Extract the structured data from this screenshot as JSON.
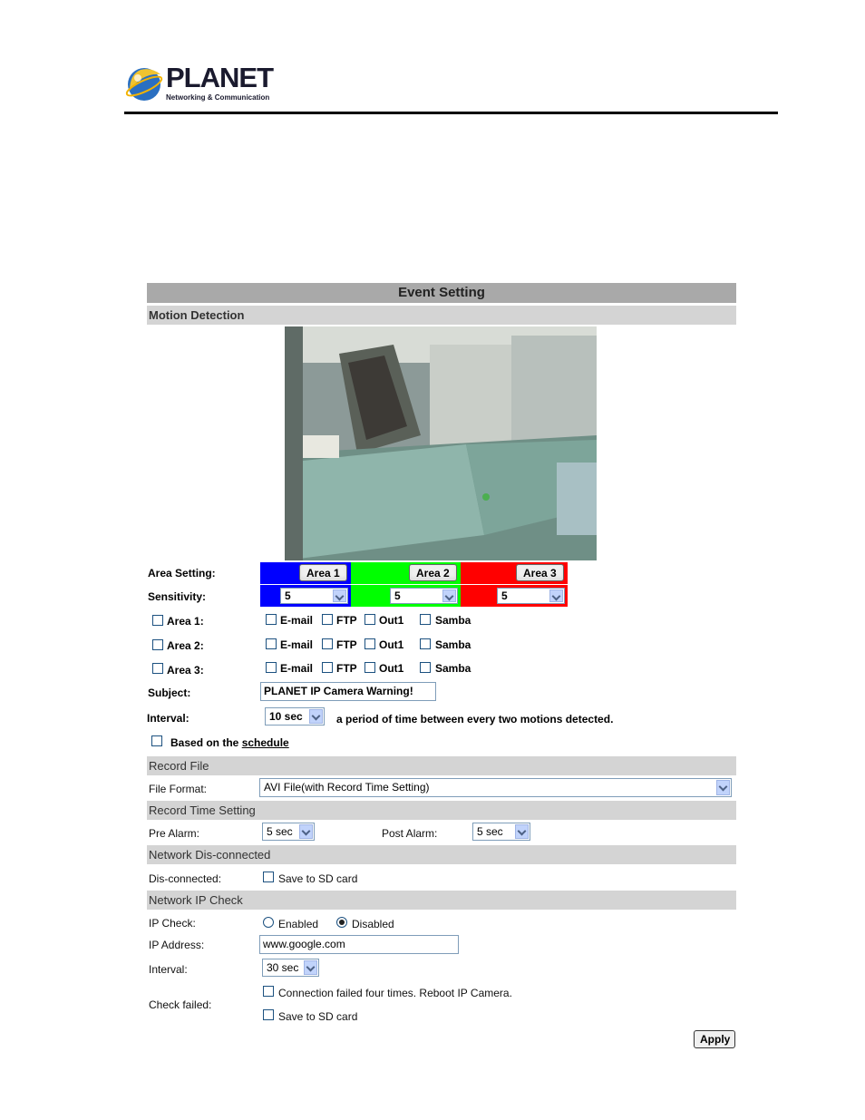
{
  "brand": {
    "name": "PLANET",
    "tagline": "Networking & Communication"
  },
  "page_title": "Event Setting",
  "motion": {
    "section": "Motion Detection",
    "area_setting_label": "Area Setting:",
    "sensitivity_label": "Sensitivity:",
    "areas": [
      {
        "button": "Area 1",
        "sensitivity": "5",
        "color": "#0000ff"
      },
      {
        "button": "Area 2",
        "sensitivity": "5",
        "color": "#00ff00"
      },
      {
        "button": "Area 3",
        "sensitivity": "5",
        "color": "#ff0000"
      }
    ],
    "rows": [
      {
        "label": "Area 1:"
      },
      {
        "label": "Area 2:"
      },
      {
        "label": "Area 3:"
      }
    ],
    "actions": {
      "email": "E-mail",
      "ftp": "FTP",
      "out1": "Out1",
      "samba": "Samba"
    },
    "subject_label": "Subject:",
    "subject_value": "PLANET IP Camera Warning!",
    "interval_label": "Interval:",
    "interval_value": "10 sec",
    "interval_desc": "a period of time between every two motions detected.",
    "schedule_prefix": "Based on the",
    "schedule_link": "schedule"
  },
  "record_file": {
    "section": "Record File",
    "format_label": "File Format:",
    "format_value": "AVI File(with Record Time Setting)"
  },
  "record_time": {
    "section": "Record Time Setting",
    "pre_label": "Pre Alarm:",
    "pre_value": "5 sec",
    "post_label": "Post Alarm:",
    "post_value": "5 sec"
  },
  "network_disconnected": {
    "section": "Network Dis-connected",
    "label": "Dis-connected:",
    "option": "Save to SD card"
  },
  "network_ip_check": {
    "section": "Network IP Check",
    "ip_check_label": "IP Check:",
    "enabled": "Enabled",
    "disabled": "Disabled",
    "ip_address_label": "IP Address:",
    "ip_address_value": "www.google.com",
    "interval_label": "Interval:",
    "interval_value": "30 sec",
    "check_failed_label": "Check failed:",
    "reboot_option": "Connection failed four times. Reboot IP Camera.",
    "sd_option": "Save to SD card"
  },
  "apply_label": "Apply"
}
